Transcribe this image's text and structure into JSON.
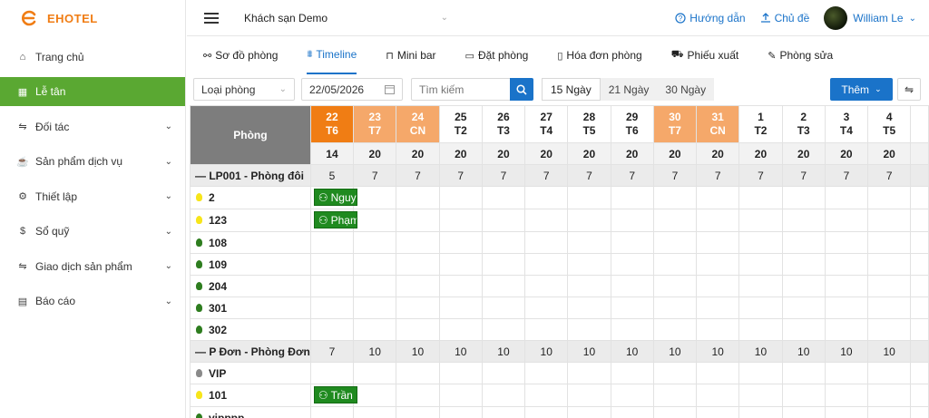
{
  "sidebar": {
    "logo_text": "EHOTEL",
    "items": [
      {
        "label": "Trang chủ",
        "icon": "home-icon",
        "glyph": "⌂",
        "chevron": false,
        "active": false
      },
      {
        "label": "Lễ tân",
        "icon": "grid-icon",
        "glyph": "▦",
        "chevron": false,
        "active": true
      },
      {
        "label": "Đối tác",
        "icon": "swap-icon",
        "glyph": "⇋",
        "chevron": true,
        "active": false
      },
      {
        "label": "Sản phẩm dịch vụ",
        "icon": "cup-icon",
        "glyph": "☕",
        "chevron": true,
        "active": false
      },
      {
        "label": "Thiết lập",
        "icon": "gear-icon",
        "glyph": "⚙",
        "chevron": true,
        "active": false
      },
      {
        "label": "Sổ quỹ",
        "icon": "dollar-icon",
        "glyph": "$",
        "chevron": true,
        "active": false
      },
      {
        "label": "Giao dịch sản phẩm",
        "icon": "swap-icon",
        "glyph": "⇋",
        "chevron": true,
        "active": false
      },
      {
        "label": "Báo cáo",
        "icon": "report-icon",
        "glyph": "▤",
        "chevron": true,
        "active": false
      }
    ]
  },
  "topbar": {
    "hotel": "Khách sạn Demo",
    "help": "Hướng dẫn",
    "theme": "Chủ đề",
    "user": "William Le"
  },
  "tabs": [
    {
      "label": "Sơ đồ phòng",
      "icon": "sitemap-icon",
      "glyph": "⚯",
      "active": false
    },
    {
      "label": "Timeline",
      "icon": "timeline-icon",
      "glyph": "⩩",
      "active": true
    },
    {
      "label": "Mini bar",
      "icon": "bag-icon",
      "glyph": "⊓",
      "active": false
    },
    {
      "label": "Đặt phòng",
      "icon": "calendar-icon",
      "glyph": "▭",
      "active": false
    },
    {
      "label": "Hóa đơn phòng",
      "icon": "invoice-icon",
      "glyph": "▯",
      "active": false
    },
    {
      "label": "Phiếu xuất",
      "icon": "cart-icon",
      "glyph": "⛟",
      "active": false
    },
    {
      "label": "Phòng sửa",
      "icon": "wrench-icon",
      "glyph": "✎",
      "active": false
    }
  ],
  "filters": {
    "room_type": "Loại phòng",
    "date": "22/05/2026",
    "search_placeholder": "Tìm kiếm",
    "ranges": [
      "15 Ngày",
      "21 Ngày",
      "30 Ngày"
    ],
    "add_label": "Thêm"
  },
  "grid": {
    "room_header": "Phòng",
    "days": [
      {
        "date": "22",
        "dow": "T6",
        "kind": "today",
        "count": "14"
      },
      {
        "date": "23",
        "dow": "T7",
        "kind": "weekend",
        "count": "20"
      },
      {
        "date": "24",
        "dow": "CN",
        "kind": "weekend",
        "count": "20"
      },
      {
        "date": "25",
        "dow": "T2",
        "kind": "",
        "count": "20"
      },
      {
        "date": "26",
        "dow": "T3",
        "kind": "",
        "count": "20"
      },
      {
        "date": "27",
        "dow": "T4",
        "kind": "",
        "count": "20"
      },
      {
        "date": "28",
        "dow": "T5",
        "kind": "",
        "count": "20"
      },
      {
        "date": "29",
        "dow": "T6",
        "kind": "",
        "count": "20"
      },
      {
        "date": "30",
        "dow": "T7",
        "kind": "weekend",
        "count": "20"
      },
      {
        "date": "31",
        "dow": "CN",
        "kind": "weekend",
        "count": "20"
      },
      {
        "date": "1",
        "dow": "T2",
        "kind": "",
        "count": "20"
      },
      {
        "date": "2",
        "dow": "T3",
        "kind": "",
        "count": "20"
      },
      {
        "date": "3",
        "dow": "T4",
        "kind": "",
        "count": "20"
      },
      {
        "date": "4",
        "dow": "T5",
        "kind": "",
        "count": "20"
      }
    ],
    "rows": [
      {
        "type": "cat",
        "name": "— LP001 - Phòng đôi",
        "values": [
          "5",
          "7",
          "7",
          "7",
          "7",
          "7",
          "7",
          "7",
          "7",
          "7",
          "7",
          "7",
          "7",
          "7"
        ]
      },
      {
        "type": "room",
        "name": "2",
        "bulb": "yellow",
        "booking": {
          "label": "Nguyễn",
          "start": 0
        }
      },
      {
        "type": "room",
        "name": "123",
        "bulb": "yellow",
        "booking": {
          "label": "Phạm",
          "start": 0
        }
      },
      {
        "type": "room",
        "name": "108",
        "bulb": "green"
      },
      {
        "type": "room",
        "name": "109",
        "bulb": "green"
      },
      {
        "type": "room",
        "name": "204",
        "bulb": "green"
      },
      {
        "type": "room",
        "name": "301",
        "bulb": "green"
      },
      {
        "type": "room",
        "name": "302",
        "bulb": "green"
      },
      {
        "type": "cat",
        "name": "— P Đơn - Phòng Đơn",
        "values": [
          "7",
          "10",
          "10",
          "10",
          "10",
          "10",
          "10",
          "10",
          "10",
          "10",
          "10",
          "10",
          "10",
          "10"
        ]
      },
      {
        "type": "room",
        "name": "VIP",
        "bulb": "gray"
      },
      {
        "type": "room",
        "name": "101",
        "bulb": "yellow",
        "booking": {
          "label": "Trần",
          "start": 0
        }
      },
      {
        "type": "room",
        "name": "vipppp",
        "bulb": "green"
      }
    ]
  }
}
